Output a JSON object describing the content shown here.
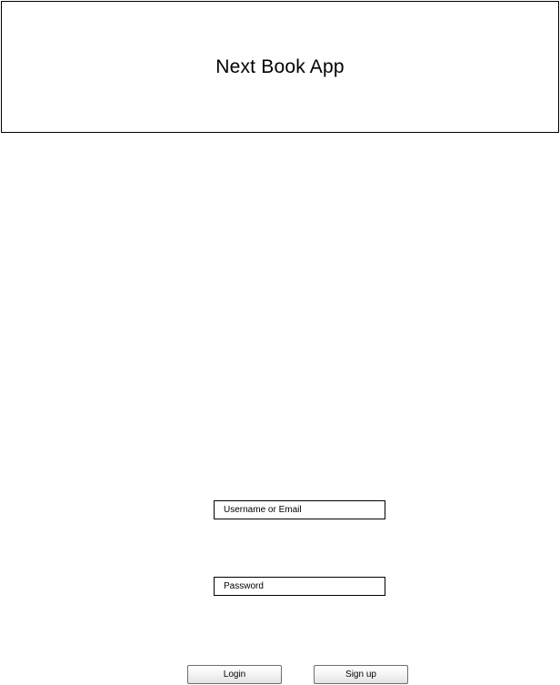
{
  "header": {
    "title": "Next Book App"
  },
  "login_form": {
    "username_placeholder": "Username or Email",
    "password_placeholder": "Password",
    "login_label": "Login",
    "signup_label": "Sign up"
  }
}
